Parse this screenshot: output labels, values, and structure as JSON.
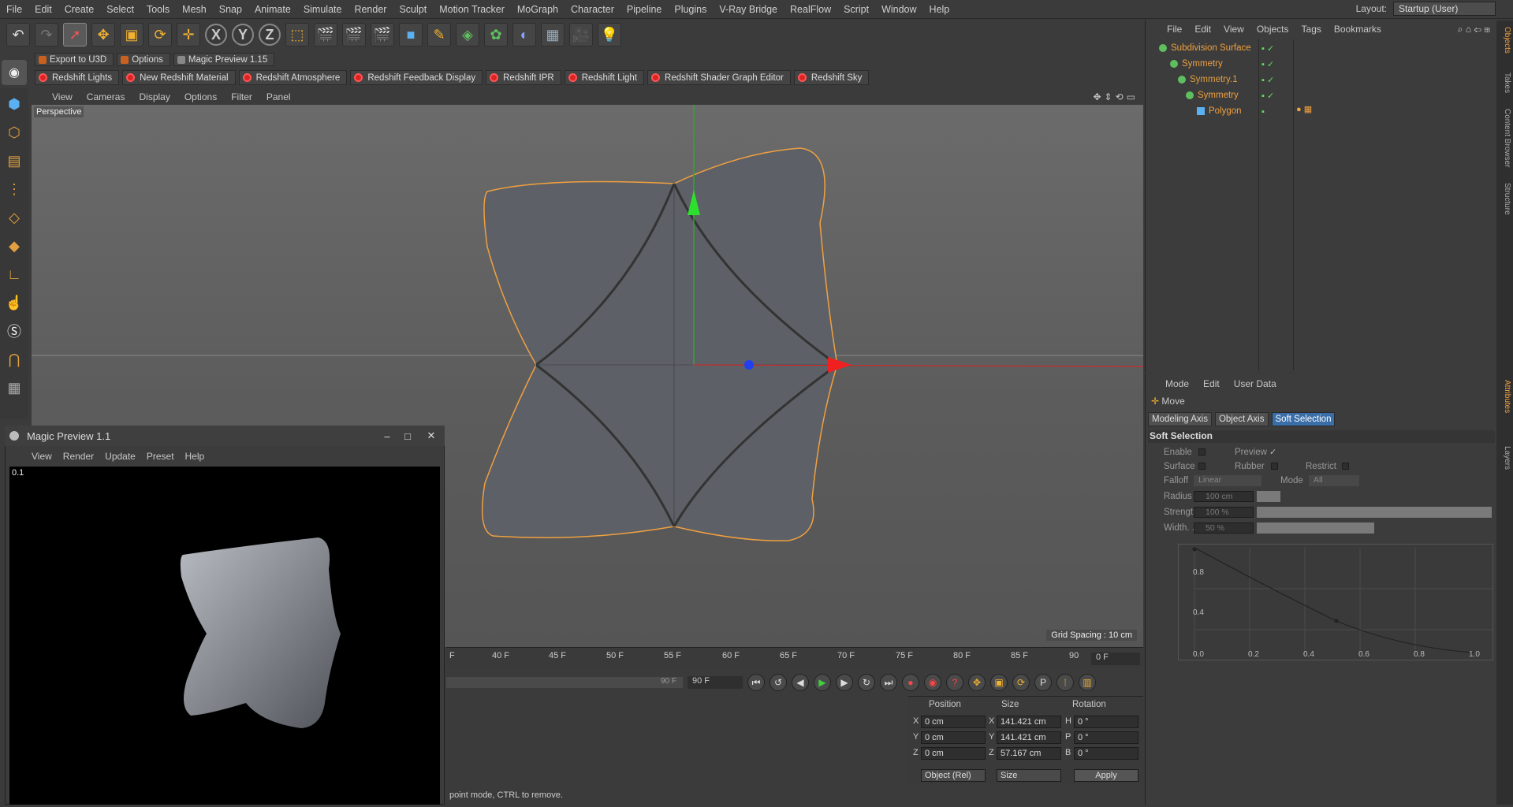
{
  "menubar": {
    "items": [
      "File",
      "Edit",
      "Create",
      "Select",
      "Tools",
      "Mesh",
      "Snap",
      "Animate",
      "Simulate",
      "Render",
      "Sculpt",
      "Motion Tracker",
      "MoGraph",
      "Character",
      "Pipeline",
      "Plugins",
      "V-Ray Bridge",
      "RealFlow",
      "Script",
      "Window",
      "Help"
    ],
    "layout_label": "Layout:",
    "layout_value": "Startup (User)"
  },
  "pluginbar": [
    "Export to U3D",
    "Options",
    "Magic Preview 1.15"
  ],
  "redshift": [
    "Redshift Lights",
    "New Redshift Material",
    "Redshift Atmosphere",
    "Redshift Feedback Display",
    "Redshift IPR",
    "Redshift Light",
    "Redshift Shader Graph Editor",
    "Redshift Sky"
  ],
  "viewport": {
    "menu": [
      "View",
      "Cameras",
      "Display",
      "Options",
      "Filter",
      "Panel"
    ],
    "tag": "Perspective",
    "grid": "Grid Spacing : 10 cm"
  },
  "timeline": {
    "ticks": [
      "40 F",
      "45 F",
      "50 F",
      "55 F",
      "60 F",
      "65 F",
      "70 F",
      "75 F",
      "80 F",
      "85 F",
      "90"
    ],
    "start_prefix": "F",
    "current": "0 F",
    "end_field": "90 F",
    "end_slider": "90 F"
  },
  "coords": {
    "h_position": "Position",
    "h_size": "Size",
    "h_rotation": "Rotation",
    "pos": [
      "0 cm",
      "0 cm",
      "0 cm"
    ],
    "size": [
      "141.421 cm",
      "141.421 cm",
      "57.167 cm"
    ],
    "rot": [
      "0 °",
      "0 °",
      "0 °"
    ],
    "axes": [
      "X",
      "Y",
      "Z"
    ],
    "rot_axes": [
      "H",
      "P",
      "B"
    ],
    "mode": "Object (Rel)",
    "size_mode": "Size",
    "apply": "Apply"
  },
  "status": "point mode, CTRL to remove.",
  "preview": {
    "title": "Magic Preview 1.1",
    "menu": [
      "View",
      "Render",
      "Update",
      "Preset",
      "Help"
    ],
    "fps": "0.1"
  },
  "objects": {
    "menu": [
      "File",
      "Edit",
      "View",
      "Objects",
      "Tags",
      "Bookmarks"
    ],
    "rows": [
      "Subdivision Surface",
      "Symmetry",
      "Symmetry.1",
      "Symmetry",
      "Polygon"
    ]
  },
  "attributes": {
    "menu": [
      "Mode",
      "Edit",
      "User Data"
    ],
    "tool": "Move",
    "tabs": [
      "Modeling Axis",
      "Object Axis",
      "Soft Selection"
    ],
    "section": "Soft Selection",
    "enable": "Enable",
    "preview": "Preview",
    "preview_mark": "✓",
    "surface": "Surface",
    "rubber": "Rubber",
    "restrict": "Restrict",
    "falloff": "Falloff",
    "falloff_val": "Linear",
    "mode": "Mode",
    "mode_val": "All",
    "radius": "Radius",
    "radius_val": "100 cm",
    "strength": "Strength",
    "strength_val": "100 %",
    "width": "Width. .",
    "width_val": "50 %",
    "graph_y": [
      "0.8",
      "0.4"
    ],
    "graph_x": [
      "0.0",
      "0.2",
      "0.4",
      "0.6",
      "0.8",
      "1.0"
    ]
  },
  "sidetabs": [
    "Objects",
    "Takes",
    "Content Browser",
    "Structure",
    "Attributes",
    "Layers"
  ]
}
